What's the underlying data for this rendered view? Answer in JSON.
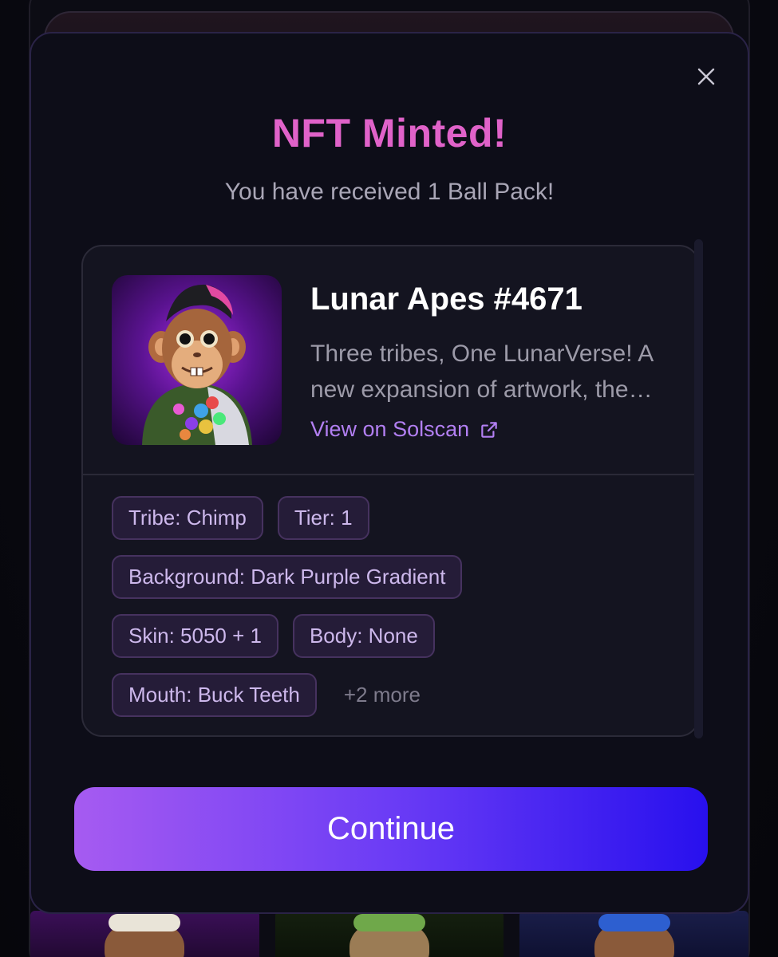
{
  "modal": {
    "title": "NFT Minted!",
    "subtitle": "You have received 1 Ball Pack!",
    "close_icon": "close-icon",
    "continue_label": "Continue"
  },
  "nft": {
    "name": "Lunar Apes #4671",
    "description": "Three tribes, One LunarVerse! A new expansion of artwork, the Lunar Apes collection…",
    "link_label": "View on Solscan",
    "link_icon": "external-link-icon",
    "traits": [
      "Tribe: Chimp",
      "Tier: 1",
      "Background: Dark Purple Gradient",
      "Skin: 5050 + 1",
      "Body: None",
      "Mouth: Buck Teeth"
    ],
    "more_label": "+2 more"
  },
  "colors": {
    "title_pink": "#e062c9",
    "link_purple": "#b27ff2",
    "button_gradient_start": "#a65bf1",
    "button_gradient_end": "#2810ee",
    "chip_bg": "#251c38"
  }
}
